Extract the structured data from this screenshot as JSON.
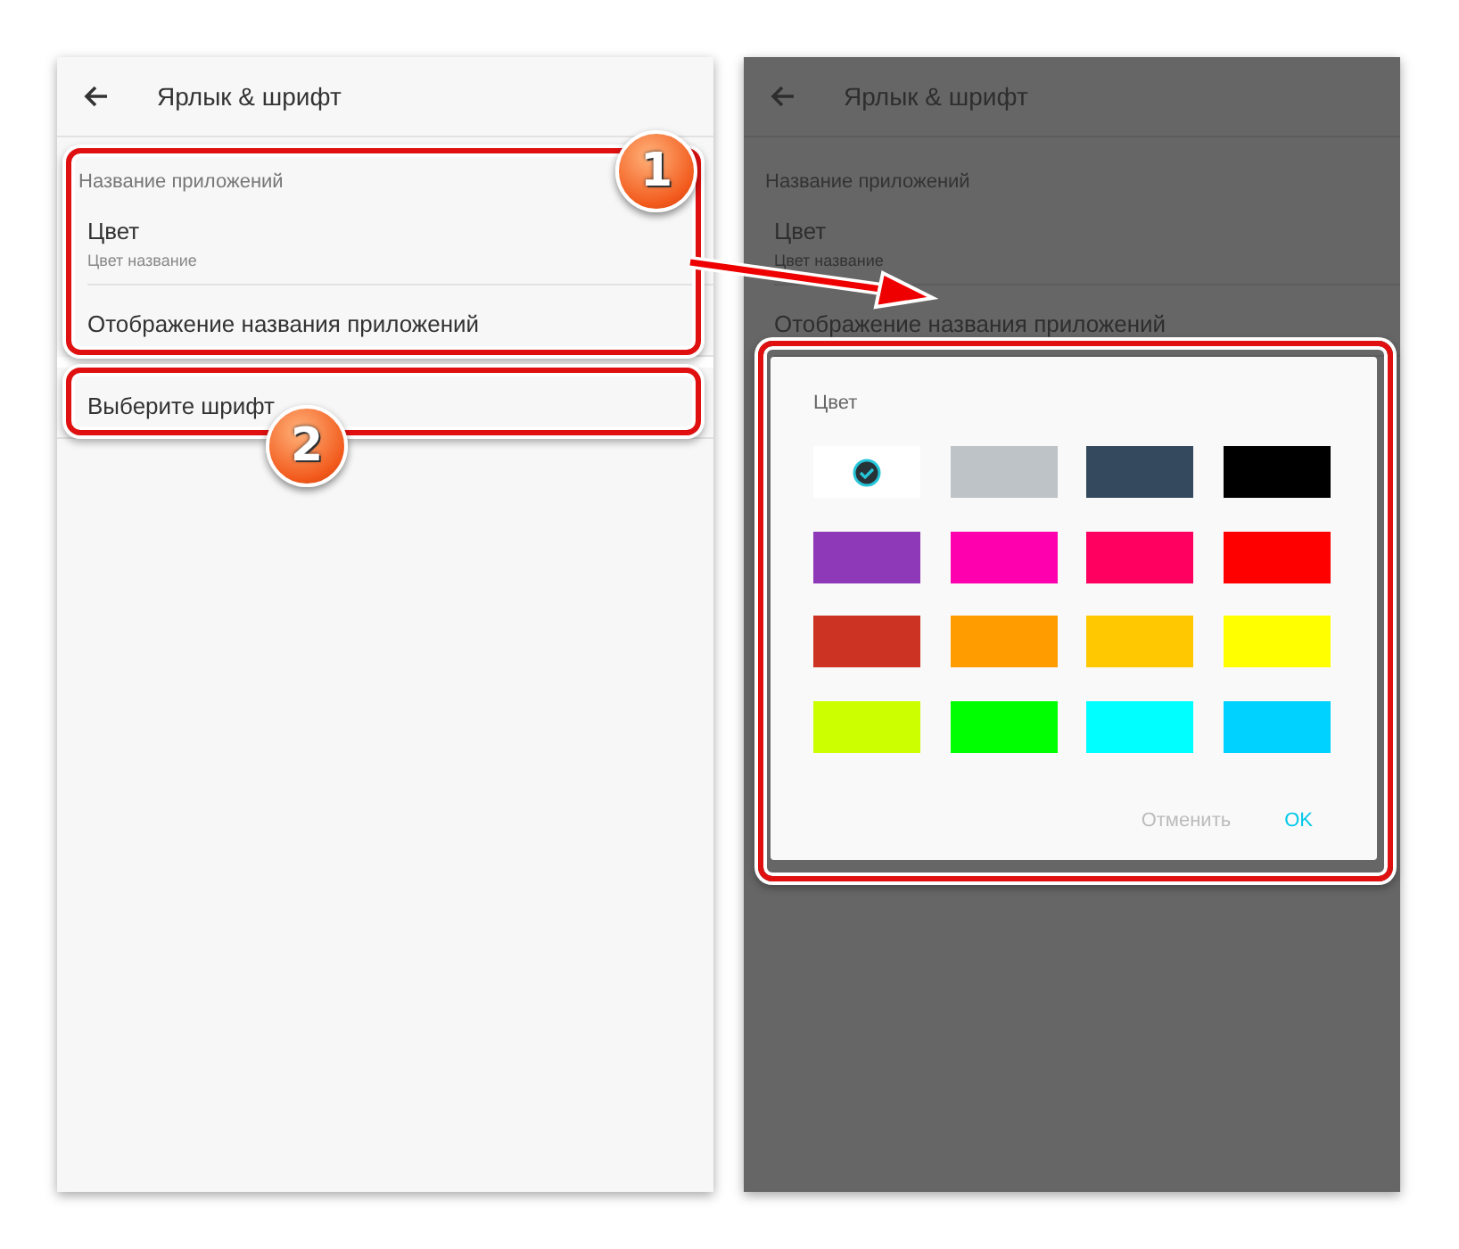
{
  "screens": [
    {
      "dimmed": false,
      "title": "Ярлык & шрифт",
      "section": "Название приложений",
      "items": [
        {
          "title": "Цвет",
          "subtitle": "Цвет название"
        },
        {
          "title": "Отображение названия приложений"
        },
        {
          "title": "Выберите шрифт"
        }
      ]
    },
    {
      "dimmed": true,
      "title": "Ярлык & шрифт",
      "section": "Название приложений",
      "items": [
        {
          "title": "Цвет",
          "subtitle": "Цвет название"
        },
        {
          "title": "Отображение названия приложений"
        }
      ]
    }
  ],
  "dialog": {
    "title": "Цвет",
    "swatches": [
      {
        "color": "#ffffff",
        "selected": true
      },
      {
        "color": "#bdc3c7",
        "selected": false
      },
      {
        "color": "#34495e",
        "selected": false
      },
      {
        "color": "#000000",
        "selected": false
      },
      {
        "color": "#8e3ab8",
        "selected": false
      },
      {
        "color": "#ff00ae",
        "selected": false
      },
      {
        "color": "#ff0060",
        "selected": false
      },
      {
        "color": "#ff0000",
        "selected": false
      },
      {
        "color": "#cc3322",
        "selected": false
      },
      {
        "color": "#ff9c00",
        "selected": false
      },
      {
        "color": "#ffc800",
        "selected": false
      },
      {
        "color": "#ffff00",
        "selected": false
      },
      {
        "color": "#ccff00",
        "selected": false
      },
      {
        "color": "#00ff00",
        "selected": false
      },
      {
        "color": "#00ffff",
        "selected": false
      },
      {
        "color": "#00d2ff",
        "selected": false
      }
    ],
    "buttons": [
      {
        "label": "Отменить",
        "kind": "cancel"
      },
      {
        "label": "OK",
        "kind": "confirm"
      }
    ]
  },
  "callouts": [
    {
      "number": "1"
    },
    {
      "number": "2"
    }
  ]
}
